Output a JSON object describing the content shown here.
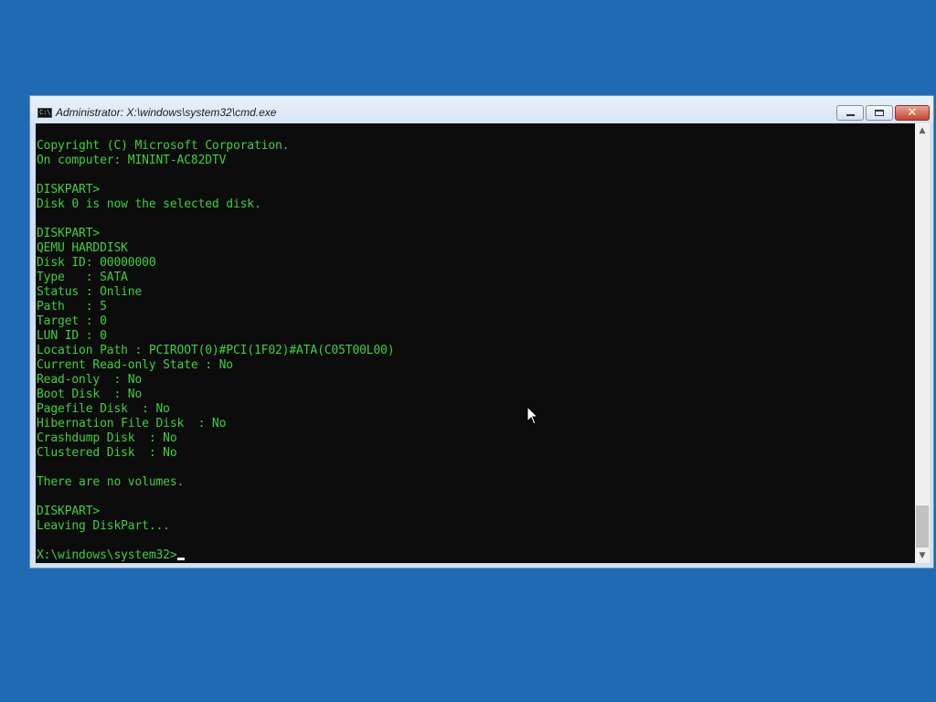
{
  "window": {
    "title": "Administrator: X:\\windows\\system32\\cmd.exe",
    "icon_label": "C:\\",
    "controls": {
      "minimize": "minimize-icon",
      "maximize": "maximize-icon",
      "close_glyph": "✕"
    }
  },
  "console": {
    "lines": [
      "Copyright (C) Microsoft Corporation.",
      "On computer: MININT-AC82DTV",
      "",
      "DISKPART>",
      "Disk 0 is now the selected disk.",
      "",
      "DISKPART>",
      "QEMU HARDDISK",
      "Disk ID: 00000000",
      "Type   : SATA",
      "Status : Online",
      "Path   : 5",
      "Target : 0",
      "LUN ID : 0",
      "Location Path : PCIROOT(0)#PCI(1F02)#ATA(C05T00L00)",
      "Current Read-only State : No",
      "Read-only  : No",
      "Boot Disk  : No",
      "Pagefile Disk  : No",
      "Hibernation File Disk  : No",
      "Crashdump Disk  : No",
      "Clustered Disk  : No",
      "",
      "There are no volumes.",
      "",
      "DISKPART>",
      "Leaving DiskPart...",
      ""
    ],
    "prompt": "X:\\windows\\system32>",
    "text_color": "#3ecf3e",
    "background_color": "#0c0c0c"
  },
  "scrollbar": {
    "up_arrow": "▲",
    "down_arrow": "▼"
  },
  "desktop": {
    "background_color": "#1f6ab3"
  }
}
